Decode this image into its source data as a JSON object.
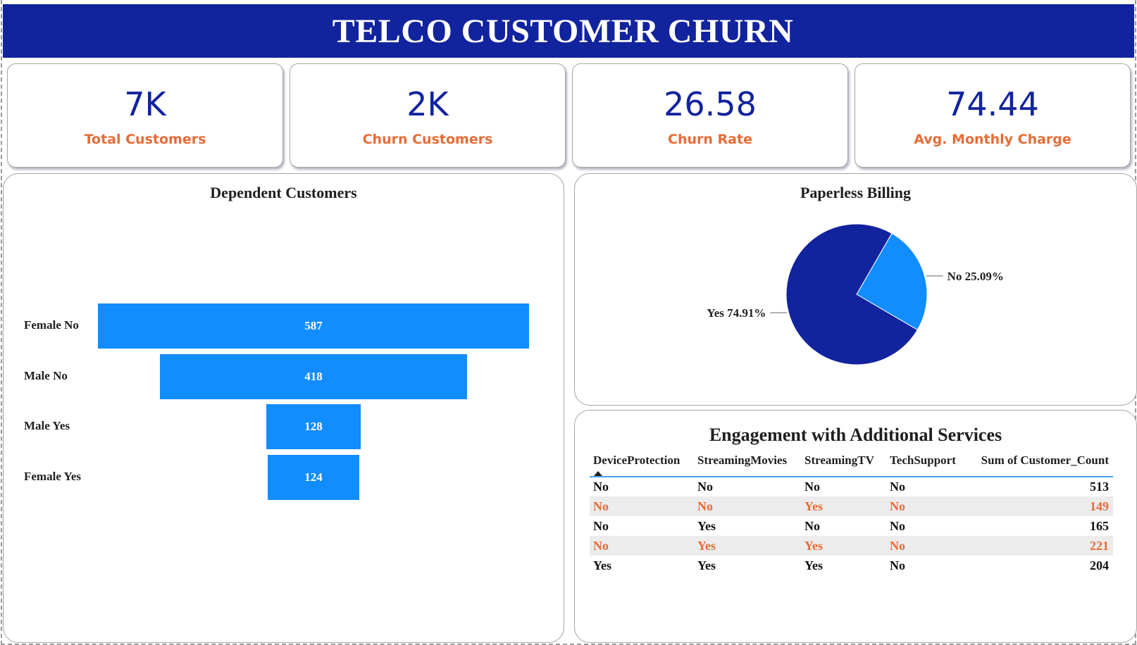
{
  "header": {
    "title": "TELCO CUSTOMER CHURN"
  },
  "kpis": [
    {
      "value": "7K",
      "label": "Total Customers"
    },
    {
      "value": "2K",
      "label": "Churn Customers"
    },
    {
      "value": "26.58",
      "label": "Churn Rate"
    },
    {
      "value": "74.44",
      "label": "Avg. Monthly Charge"
    }
  ],
  "colors": {
    "header": "#12239e",
    "kpi_value": "#12239e",
    "kpi_label": "#e66c37",
    "bar": "#118dff",
    "pie_yes": "#12239e",
    "pie_no": "#118dff",
    "table_alt": "#e66c37"
  },
  "chart_data": [
    {
      "type": "bar",
      "subtype": "funnel",
      "title": "Dependent Customers",
      "categories": [
        "Female No",
        "Male No",
        "Male Yes",
        "Female Yes"
      ],
      "values": [
        587,
        418,
        128,
        124
      ],
      "value_labels": [
        "587",
        "418",
        "128",
        "124"
      ]
    },
    {
      "type": "pie",
      "title": "Paperless Billing",
      "labels": [
        "Yes",
        "No"
      ],
      "values": [
        74.91,
        25.09
      ],
      "slice_labels": [
        "Yes 74.91%",
        "No 25.09%"
      ]
    },
    {
      "type": "table",
      "title": "Engagement with Additional Services",
      "columns": [
        "DeviceProtection",
        "StreamingMovies",
        "StreamingTV",
        "TechSupport",
        "Sum of Customer_Count"
      ],
      "sorted_column": "DeviceProtection",
      "rows": [
        [
          "No",
          "No",
          "No",
          "No",
          "513"
        ],
        [
          "No",
          "No",
          "Yes",
          "No",
          "149"
        ],
        [
          "No",
          "Yes",
          "No",
          "No",
          "165"
        ],
        [
          "No",
          "Yes",
          "Yes",
          "No",
          "221"
        ],
        [
          "Yes",
          "Yes",
          "Yes",
          "No",
          "204"
        ]
      ]
    }
  ]
}
